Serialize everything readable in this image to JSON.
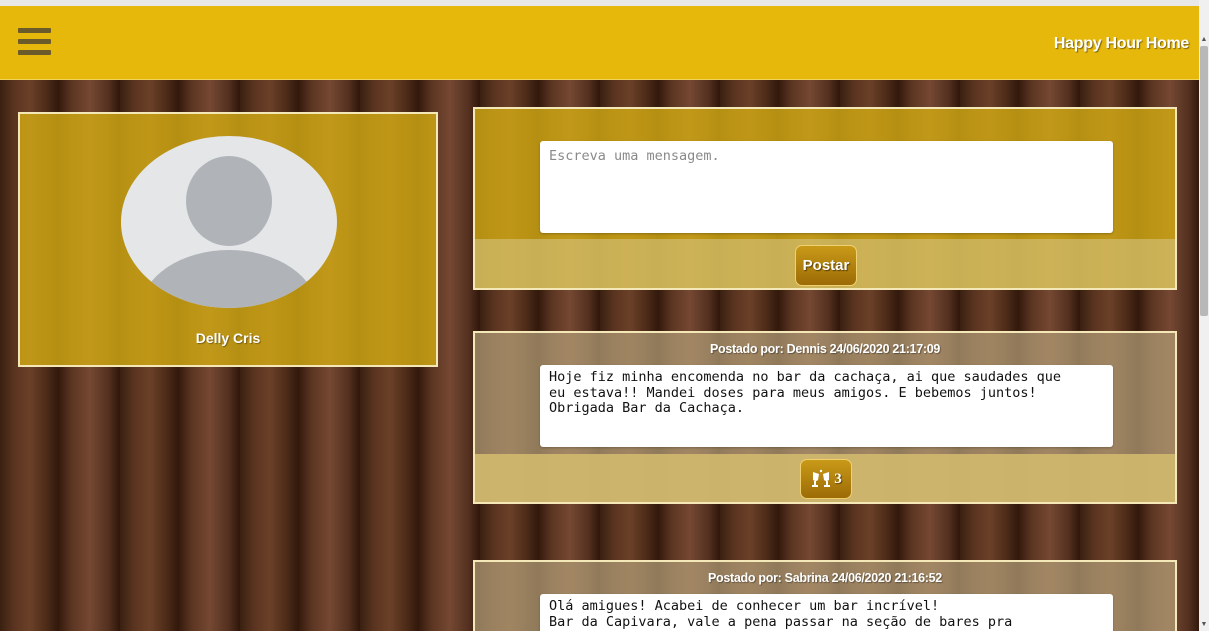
{
  "header": {
    "brand": "Happy Hour Home",
    "menu_icon": "hamburger-menu-icon",
    "color": "#e6b80b"
  },
  "profile": {
    "name": "Delly Cris",
    "avatar_icon": "user-avatar-placeholder"
  },
  "compose": {
    "placeholder": "Escreva uma mensagem.",
    "value": "",
    "submit_label": "Postar"
  },
  "posts": [
    {
      "meta": "Postado por: Dennis 24/06/2020 21:17:09",
      "body": "Hoje fiz minha encomenda no bar da cachaça, ai que saudades que\neu estava!! Mandei doses para meus amigos. E bebemos juntos!\nObrigada Bar da Cachaça.",
      "cheers_icon": "cheers-glasses-icon",
      "cheers_count": "3"
    },
    {
      "meta": "Postado por: Sabrina 24/06/2020 21:16:52",
      "body": "Olá amigues! Acabei de conhecer um bar incrível!\nBar da Capivara, vale a pena passar na seção de bares pra"
    }
  ]
}
